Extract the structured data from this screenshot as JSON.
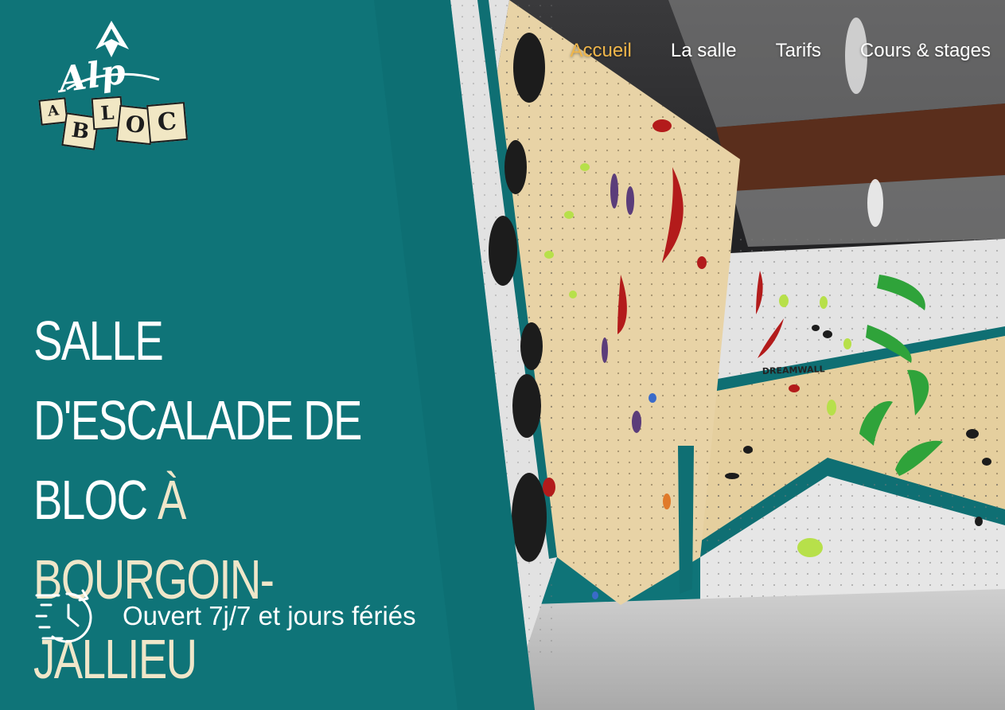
{
  "brand": {
    "logo_script": "Alp",
    "logo_blocks": [
      "A",
      "B",
      "L",
      "O",
      "C"
    ],
    "accent_color": "#0f7478"
  },
  "nav": {
    "items": [
      {
        "label": "Accueil",
        "active": true
      },
      {
        "label": "La salle",
        "active": false
      },
      {
        "label": "Tarifs",
        "active": false
      },
      {
        "label": "Cours & stages",
        "active": false
      }
    ],
    "active_color": "#f0b64a"
  },
  "hero": {
    "title_part1": "SALLE D'ESCALADE DE BLOC",
    "title_part2": "À BOURGOIN-JALLIEU",
    "title_accent_color": "#efe6c9",
    "photo_wall_sign": "DREAMWALL"
  },
  "hours": {
    "icon": "clock-fast-icon",
    "text": "Ouvert 7j/7 et jours fériés"
  }
}
